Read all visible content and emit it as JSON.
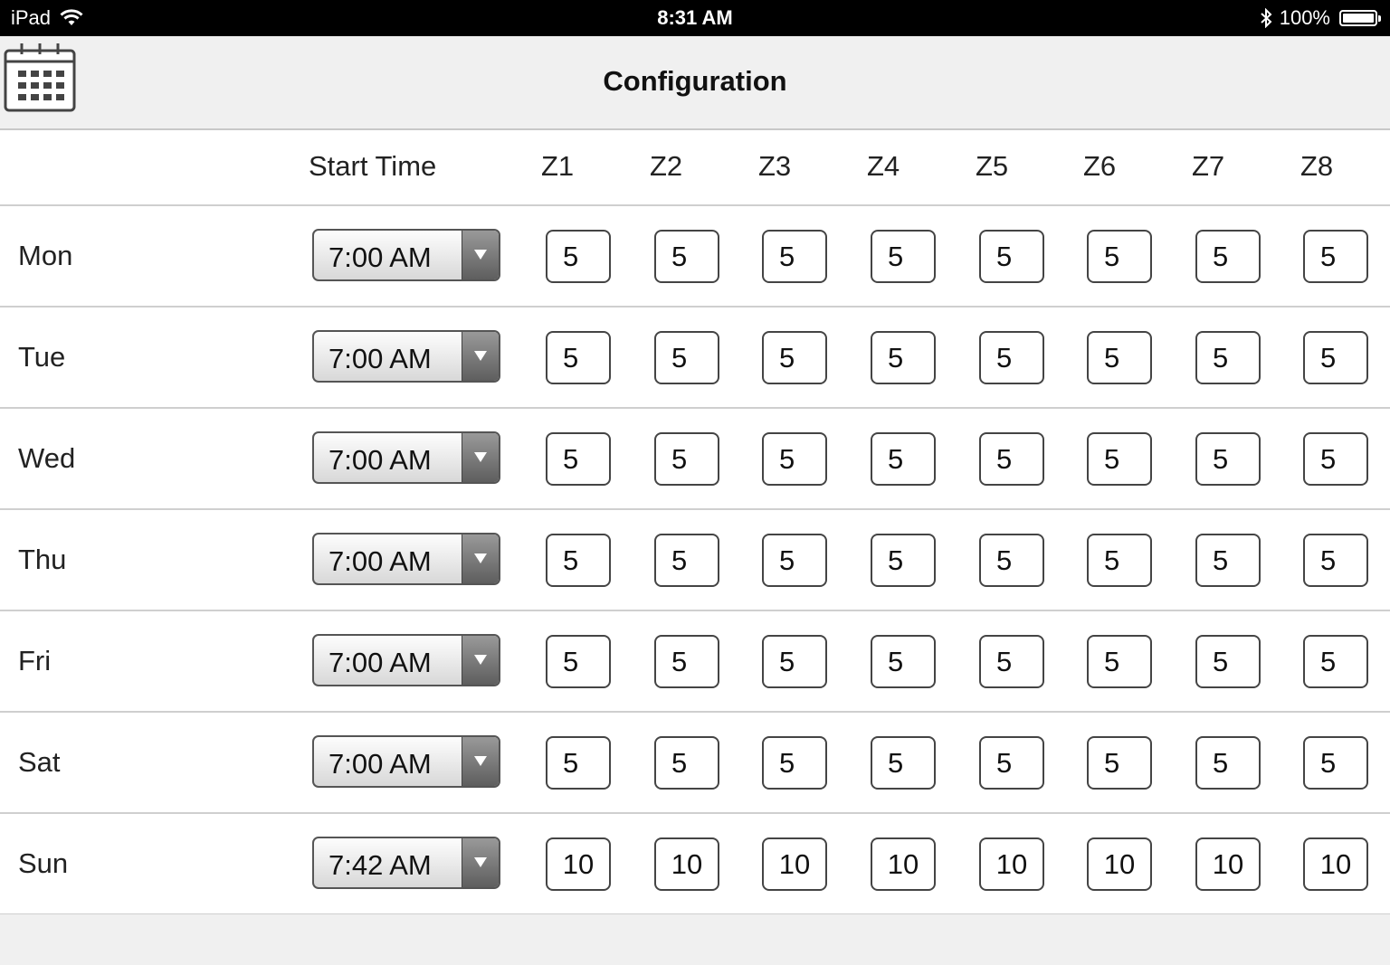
{
  "status_bar": {
    "device": "iPad",
    "time": "8:31 AM",
    "battery": "100%"
  },
  "nav": {
    "title": "Configuration",
    "calendar_icon": "calendar-icon"
  },
  "table": {
    "start_time_header": "Start Time",
    "zones": [
      "Z1",
      "Z2",
      "Z3",
      "Z4",
      "Z5",
      "Z6",
      "Z7",
      "Z8"
    ],
    "rows": [
      {
        "day": "Mon",
        "start": "7:00 AM",
        "values": [
          "5",
          "5",
          "5",
          "5",
          "5",
          "5",
          "5",
          "5"
        ]
      },
      {
        "day": "Tue",
        "start": "7:00 AM",
        "values": [
          "5",
          "5",
          "5",
          "5",
          "5",
          "5",
          "5",
          "5"
        ]
      },
      {
        "day": "Wed",
        "start": "7:00 AM",
        "values": [
          "5",
          "5",
          "5",
          "5",
          "5",
          "5",
          "5",
          "5"
        ]
      },
      {
        "day": "Thu",
        "start": "7:00 AM",
        "values": [
          "5",
          "5",
          "5",
          "5",
          "5",
          "5",
          "5",
          "5"
        ]
      },
      {
        "day": "Fri",
        "start": "7:00 AM",
        "values": [
          "5",
          "5",
          "5",
          "5",
          "5",
          "5",
          "5",
          "5"
        ]
      },
      {
        "day": "Sat",
        "start": "7:00 AM",
        "values": [
          "5",
          "5",
          "5",
          "5",
          "5",
          "5",
          "5",
          "5"
        ]
      },
      {
        "day": "Sun",
        "start": "7:42 AM",
        "values": [
          "10",
          "10",
          "10",
          "10",
          "10",
          "10",
          "10",
          "10"
        ]
      }
    ]
  }
}
